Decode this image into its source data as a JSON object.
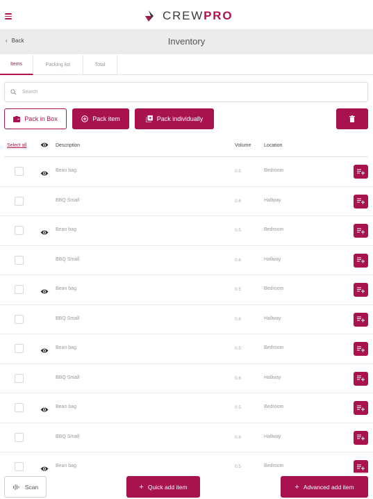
{
  "header": {
    "brand_prefix": "CREW",
    "brand_suffix": "PRO"
  },
  "titlebar": {
    "back_label": "Back",
    "title": "Inventory"
  },
  "tabs": [
    {
      "label": "Items",
      "active": true
    },
    {
      "label": "Packing list",
      "active": false
    },
    {
      "label": "Total",
      "active": false
    }
  ],
  "search": {
    "placeholder": "Search",
    "value": ""
  },
  "actions": {
    "pack_in_box": "Pack in Box",
    "pack_item": "Pack item",
    "pack_individually": "Pack individually"
  },
  "table": {
    "select_all": "Select all",
    "columns": {
      "description": "Description",
      "volume": "Volume",
      "location": "Location"
    },
    "rows": [
      {
        "description": "Bean bag",
        "volume": "0.5",
        "location": "Bedroom",
        "eye": true
      },
      {
        "description": "BBQ Small",
        "volume": "0.6",
        "location": "Hallway",
        "eye": false
      },
      {
        "description": "Bean bag",
        "volume": "0.5",
        "location": "Bedroom",
        "eye": true
      },
      {
        "description": "BBQ Small",
        "volume": "0.6",
        "location": "Hallway",
        "eye": false
      },
      {
        "description": "Bean bag",
        "volume": "0.5",
        "location": "Bedroom",
        "eye": true
      },
      {
        "description": "BBQ Small",
        "volume": "0.6",
        "location": "Hallway",
        "eye": false
      },
      {
        "description": "Bean bag",
        "volume": "0.5",
        "location": "Bedroom",
        "eye": true
      },
      {
        "description": "BBQ Small",
        "volume": "0.6",
        "location": "Hallway",
        "eye": false
      },
      {
        "description": "Bean bag",
        "volume": "0.5",
        "location": "Bedroom",
        "eye": true
      },
      {
        "description": "BBQ Small",
        "volume": "0.6",
        "location": "Hallway",
        "eye": false
      },
      {
        "description": "Bean bag",
        "volume": "0.5",
        "location": "Bedroom",
        "eye": true
      }
    ]
  },
  "bottom": {
    "scan": "Scan",
    "quick_add": "Quick add item",
    "advanced_add": "Advanced add item"
  },
  "colors": {
    "accent": "#a8124e",
    "titlebar_bg": "#ececec"
  }
}
